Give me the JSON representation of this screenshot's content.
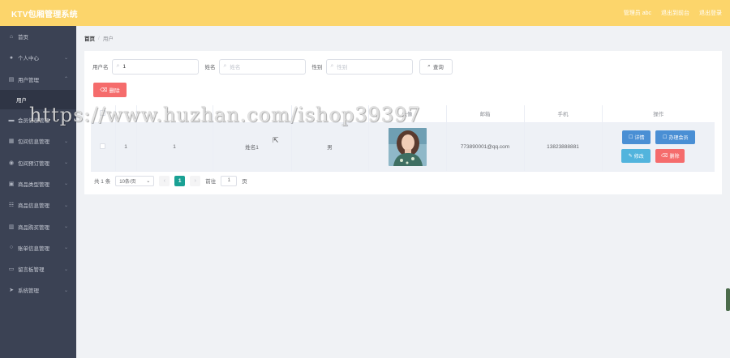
{
  "header": {
    "title": "KTV包厢管理系统",
    "links": [
      "管理员 abc",
      "退出到前台",
      "退出登录"
    ]
  },
  "sidebar": {
    "items": [
      {
        "label": "首页",
        "icon": "home-icon",
        "chev": ""
      },
      {
        "label": "个人中心",
        "icon": "user-icon",
        "chev": "⌄"
      },
      {
        "label": "用户管理",
        "icon": "users-icon",
        "chev": "⌃"
      },
      {
        "label": "会员信息管理",
        "icon": "member-icon",
        "chev": "⌄"
      },
      {
        "label": "包间信息管理",
        "icon": "room-icon",
        "chev": "⌄"
      },
      {
        "label": "包间预订管理",
        "icon": "booking-icon",
        "chev": "⌄"
      },
      {
        "label": "商品类型管理",
        "icon": "category-icon",
        "chev": "⌄"
      },
      {
        "label": "商品信息管理",
        "icon": "goods-icon",
        "chev": "⌄"
      },
      {
        "label": "商品购买管理",
        "icon": "purchase-icon",
        "chev": "⌄"
      },
      {
        "label": "账单信息管理",
        "icon": "bill-icon",
        "chev": "⌄"
      },
      {
        "label": "留言板管理",
        "icon": "message-icon",
        "chev": "⌄"
      },
      {
        "label": "系统管理",
        "icon": "system-icon",
        "chev": "⌄"
      }
    ],
    "submenu": "用户"
  },
  "breadcrumb": {
    "home": "首页",
    "sep": "/",
    "current": "用户"
  },
  "search": {
    "username_label": "用户名",
    "username_value": "1",
    "name_label": "姓名",
    "name_placeholder": "姓名",
    "gender_label": "性别",
    "gender_placeholder": "性别",
    "button": "查询"
  },
  "actions": {
    "delete": "删除"
  },
  "table": {
    "columns": [
      "",
      "",
      "",
      "",
      "",
      "头像",
      "邮箱",
      "手机",
      "操作"
    ],
    "rows": [
      {
        "index": "1",
        "username": "1",
        "name": "姓名1",
        "gender": "男",
        "email": "773890001@qq.com",
        "phone": "13823888881",
        "ops": {
          "detail": "详情",
          "member": "办理会员",
          "edit": "修改",
          "delete": "删除"
        }
      }
    ]
  },
  "pagination": {
    "total": "共 1 条",
    "page_size": "10条/页",
    "current_page": "1",
    "goto_prefix": "前往",
    "goto_value": "1",
    "goto_suffix": "页"
  },
  "watermark": "https://www.huzhan.com/ishop39397",
  "colors": {
    "header": "#fcd56b",
    "sidebar": "#3b4254",
    "danger": "#f56c6c",
    "primary": "#4a8fd4",
    "info": "#52b4dd",
    "pager_active": "#1aa194"
  }
}
